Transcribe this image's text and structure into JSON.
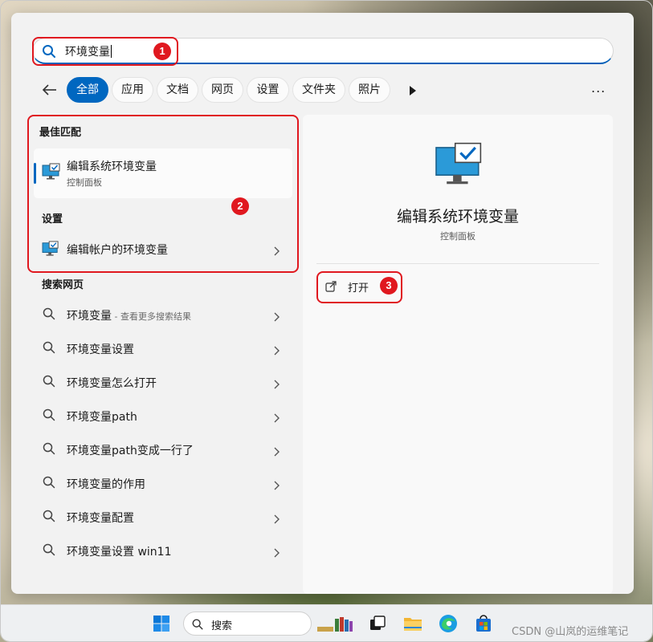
{
  "search": {
    "query": "环境变量",
    "taskbar_placeholder": "搜索"
  },
  "filters": {
    "chips": [
      "全部",
      "应用",
      "文档",
      "网页",
      "设置",
      "文件夹",
      "照片"
    ],
    "active": "全部",
    "more_label": "..."
  },
  "best_match": {
    "section_title": "最佳匹配",
    "item_title": "编辑系统环境变量",
    "item_subtitle": "控制面板"
  },
  "settings_section": {
    "section_title": "设置",
    "item_title": "编辑帐户的环境变量"
  },
  "web_section": {
    "section_title": "搜索网页",
    "items": [
      {
        "label": "环境变量",
        "suffix": " - 查看更多搜索结果"
      },
      {
        "label": "环境变量设置",
        "suffix": ""
      },
      {
        "label": "环境变量怎么打开",
        "suffix": ""
      },
      {
        "label": "环境变量path",
        "suffix": ""
      },
      {
        "label": "环境变量path变成一行了",
        "suffix": ""
      },
      {
        "label": "环境变量的作用",
        "suffix": ""
      },
      {
        "label": "环境变量配置",
        "suffix": ""
      },
      {
        "label": "环境变量设置 win11",
        "suffix": ""
      }
    ]
  },
  "detail": {
    "title": "编辑系统环境变量",
    "subtitle": "控制面板",
    "open_label": "打开"
  },
  "annotations": [
    "1",
    "2",
    "3"
  ],
  "colors": {
    "accent": "#0067c0",
    "annotation": "#e0181f"
  },
  "watermark": "CSDN @山岚的运维笔记"
}
